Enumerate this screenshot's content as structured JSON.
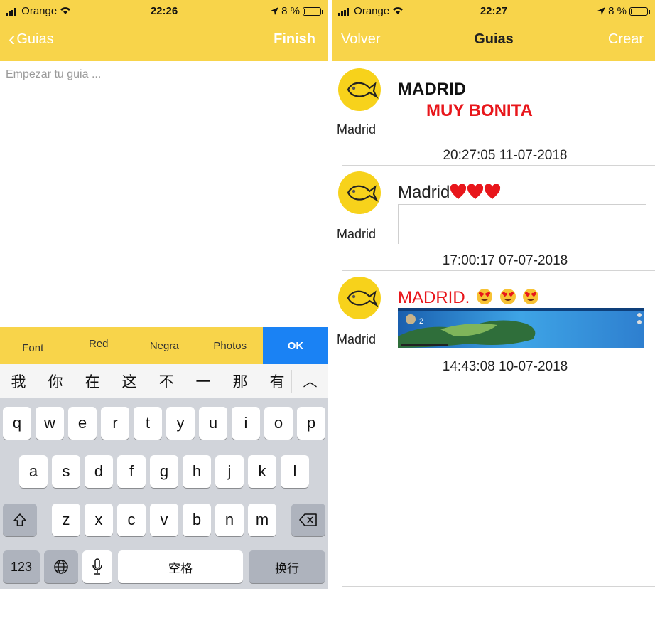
{
  "left": {
    "status": {
      "carrier": "Orange",
      "time": "22:26",
      "battery": "8 %",
      "battery_level": 0.08
    },
    "nav": {
      "back_label": "Guias",
      "finish_label": "Finish"
    },
    "editor": {
      "placeholder": "Empezar tu guia ..."
    },
    "toolbar": {
      "font": "Font",
      "red": "Red",
      "negra": "Negra",
      "photos": "Photos",
      "ok": "OK"
    },
    "candidates": [
      "我",
      "你",
      "在",
      "这",
      "不",
      "一",
      "那",
      "有"
    ],
    "keyboard": {
      "row1": [
        "q",
        "w",
        "e",
        "r",
        "t",
        "y",
        "u",
        "i",
        "o",
        "p"
      ],
      "row2": [
        "a",
        "s",
        "d",
        "f",
        "g",
        "h",
        "j",
        "k",
        "l"
      ],
      "row3": [
        "z",
        "x",
        "c",
        "v",
        "b",
        "n",
        "m"
      ],
      "num_key": "123",
      "space_key": "空格",
      "return_key": "换行"
    }
  },
  "right": {
    "status": {
      "carrier": "Orange",
      "time": "22:27",
      "battery": "8 %",
      "battery_level": 0.08
    },
    "nav": {
      "volver_label": "Volver",
      "title": "Guias",
      "crear_label": "Crear"
    },
    "entries": [
      {
        "name": "Madrid",
        "title": "MADRID",
        "subtitle": "MUY BONITA",
        "date": "20:27:05 11-07-2018"
      },
      {
        "name": "Madrid",
        "title": "Madrid",
        "date": "17:00:17 07-07-2018"
      },
      {
        "name": "Madrid",
        "title": "MADRID.",
        "date": "14:43:08 10-07-2018"
      }
    ],
    "colors": {
      "bar": "#f8d44a",
      "red": "#e8161b",
      "ok": "#1a82f4"
    }
  }
}
